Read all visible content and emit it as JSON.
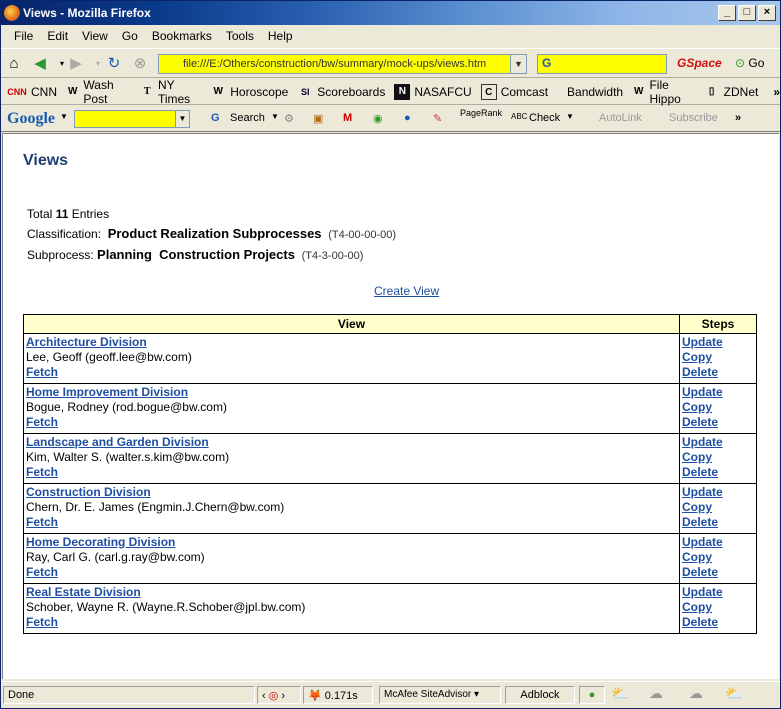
{
  "window": {
    "title": "Views - Mozilla Firefox"
  },
  "menu": [
    "File",
    "Edit",
    "View",
    "Go",
    "Bookmarks",
    "Tools",
    "Help"
  ],
  "toolbar": {
    "url": "file:///E:/Others/construction/bw/summary/mock-ups/views.htm",
    "gspace": "GSpace",
    "go": "Go"
  },
  "bookmarks": [
    {
      "icon": "cnn-icon",
      "glyph": "CNN",
      "label": "CNN"
    },
    {
      "icon": "washpost-icon",
      "glyph": "W",
      "label": "Wash Post"
    },
    {
      "icon": "nytimes-icon",
      "glyph": "T",
      "label": "NY Times"
    },
    {
      "icon": "horoscope-icon",
      "glyph": "W",
      "label": "Horoscope"
    },
    {
      "icon": "si-icon",
      "glyph": "SI",
      "label": "Scoreboards"
    },
    {
      "icon": "nasafcu-icon",
      "glyph": "N",
      "label": "NASAFCU"
    },
    {
      "icon": "comcast-icon",
      "glyph": "C",
      "label": "Comcast"
    },
    {
      "icon": "bandwidth-icon",
      "glyph": "",
      "label": "Bandwidth"
    },
    {
      "icon": "filehippo-icon",
      "glyph": "W",
      "label": "File Hippo"
    },
    {
      "icon": "zdnet-icon",
      "glyph": "▯",
      "label": "ZDNet"
    }
  ],
  "googlebar": {
    "logo": "Google",
    "search": "Search",
    "pagerank": "PageRank",
    "check": "Check",
    "autolink": "AutoLink",
    "subscribe": "Subscribe"
  },
  "page": {
    "heading": "Views",
    "total_prefix": "Total",
    "total_count": "11",
    "total_suffix": "Entries",
    "classification_label": "Classification:",
    "classification_value": "Product Realization Subprocesses",
    "classification_code": "(T4-00-00-00)",
    "subprocess_label": "Subprocess:",
    "subprocess_value": "Planning  Construction Projects",
    "subprocess_code": "(T4-3-00-00)",
    "create_view": "Create View",
    "table_headers": {
      "view": "View",
      "steps": "Steps"
    },
    "rows": [
      {
        "name": "Architecture Division",
        "owner": "Lee, Geoff (geoff.lee@bw.com)",
        "fetch": "Fetch",
        "update": "Update",
        "copy": "Copy",
        "delete": "Delete"
      },
      {
        "name": "Home Improvement Division",
        "owner": "Bogue, Rodney (rod.bogue@bw.com)",
        "fetch": "Fetch",
        "update": "Update",
        "copy": "Copy",
        "delete": "Delete"
      },
      {
        "name": "Landscape and Garden Division",
        "owner": "Kim, Walter S. (walter.s.kim@bw.com)",
        "fetch": "Fetch",
        "update": "Update",
        "copy": "Copy",
        "delete": "Delete"
      },
      {
        "name": "Construction Division",
        "owner": "Chern, Dr. E. James (Engmin.J.Chern@bw.com)",
        "fetch": "Fetch",
        "update": "Update",
        "copy": "Copy",
        "delete": "Delete"
      },
      {
        "name": "Home Decorating Division",
        "owner": "Ray, Carl G. (carl.g.ray@bw.com)",
        "fetch": "Fetch",
        "update": "Update",
        "copy": "Copy",
        "delete": "Delete"
      },
      {
        "name": "Real Estate Division",
        "owner": "Schober, Wayne R. (Wayne.R.Schober@jpl.bw.com)",
        "fetch": "Fetch",
        "update": "Update",
        "copy": "Copy",
        "delete": "Delete"
      }
    ]
  },
  "status": {
    "text": "Done",
    "timer": "0.171s",
    "mcafee": "McAfee SiteAdvisor",
    "adblock": "Adblock"
  }
}
